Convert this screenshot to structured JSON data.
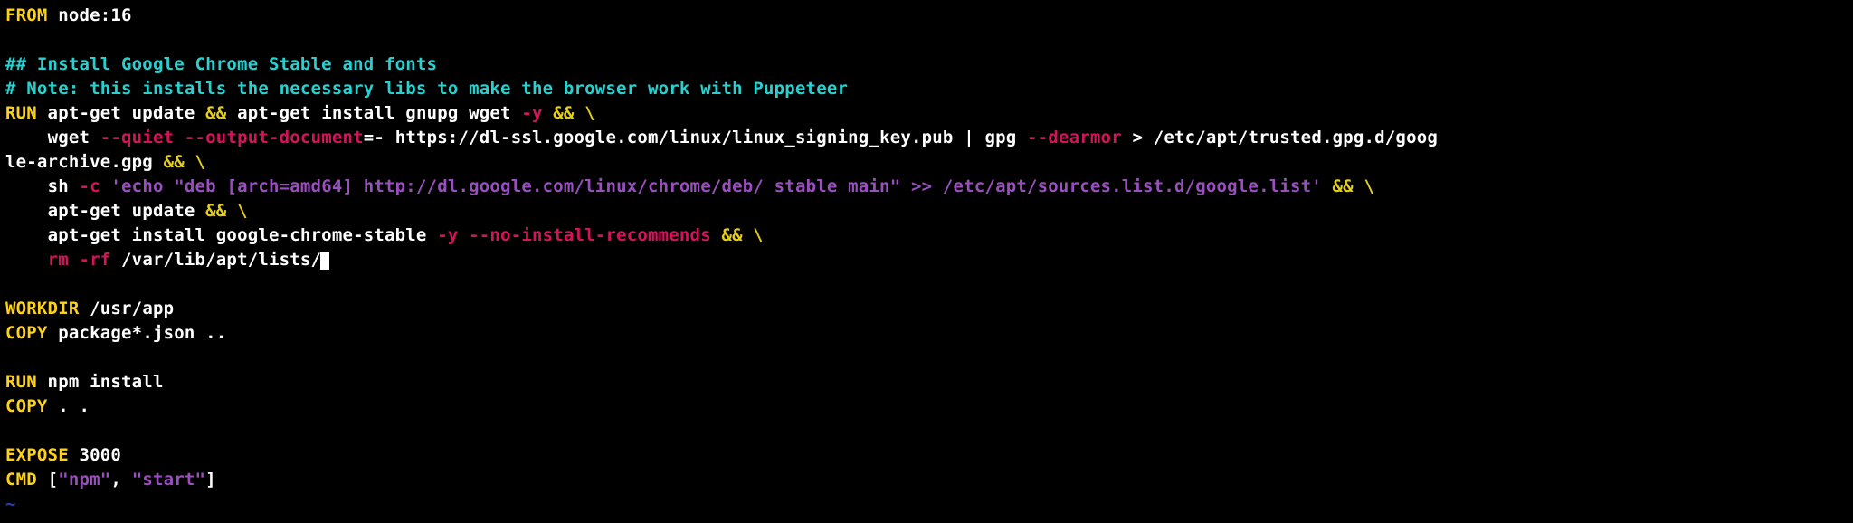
{
  "dockerfile": {
    "l01": {
      "from_kw": "FROM",
      "from_arg": " node:16"
    },
    "l02": "",
    "l03": "## Install Google Chrome Stable and fonts",
    "l04": "# Note: this installs the necessary libs to make the browser work with Puppeteer",
    "l05": {
      "run_kw": "RUN",
      "a": " apt-get update ",
      "amp1": "&&",
      "b": " apt-get install gnupg wget ",
      "flag_y": "-y",
      "sp1": " ",
      "amp2": "&&",
      "sp2": " ",
      "bs": "\\"
    },
    "l06": {
      "indent": "    ",
      "a": "wget ",
      "flag1": "--quiet",
      "sp1": " ",
      "flag2": "--output-document",
      "eq": "=",
      "dash": "- ",
      "url": "https://dl-ssl.google.com/linux/linux_signing_key.pub",
      "pipe": " | ",
      "gpg": "gpg ",
      "flag3": "--dearmor",
      "gt": " > ",
      "path": "/etc/apt/trusted.gpg.d/goog"
    },
    "l07": {
      "a": "le-archive.gpg ",
      "amp": "&&",
      "sp": " ",
      "bs": "\\"
    },
    "l08": {
      "indent": "    ",
      "sh": "sh ",
      "flag_c": "-c",
      "sp": " ",
      "q1": "'",
      "echo": "echo ",
      "dq1": "\"",
      "deb": "deb [arch=amd64] http://dl.google.com/linux/chrome/deb/ stable main",
      "dq2": "\"",
      "append": " >> /etc/apt/sources.list.d/google.list",
      "q2": "'",
      "sp2": " ",
      "amp": "&&",
      "sp3": " ",
      "bs": "\\"
    },
    "l09": {
      "indent": "    ",
      "a": "apt-get update ",
      "amp": "&&",
      "sp": " ",
      "bs": "\\"
    },
    "l10": {
      "indent": "    ",
      "a": "apt-get install google-chrome-stable ",
      "flag_y": "-y",
      "sp1": " ",
      "flag_nir": "--no-install-recommends",
      "sp2": " ",
      "amp": "&&",
      "sp3": " ",
      "bs": "\\"
    },
    "l11": {
      "indent": "    ",
      "rm": "rm",
      "sp1": " ",
      "flag_rf": "-rf",
      "sp2": " ",
      "path": "/var/lib/apt/lists/"
    },
    "l12": "",
    "l13": {
      "kw": "WORKDIR",
      "arg": " /usr/app"
    },
    "l14": {
      "kw": "COPY",
      "arg": " package*.json .."
    },
    "l15": "",
    "l16": {
      "kw": "RUN",
      "arg": " npm install"
    },
    "l17": {
      "kw": "COPY",
      "arg": " . ."
    },
    "l18": "",
    "l19": {
      "kw": "EXPOSE",
      "arg": " 3000"
    },
    "l20": {
      "kw": "CMD",
      "sp": " ",
      "lb": "[",
      "q1": "\"",
      "npm": "npm",
      "q2": "\"",
      "comma": ", ",
      "q3": "\"",
      "start": "start",
      "q4": "\"",
      "rb": "]"
    },
    "tilde": "~"
  }
}
